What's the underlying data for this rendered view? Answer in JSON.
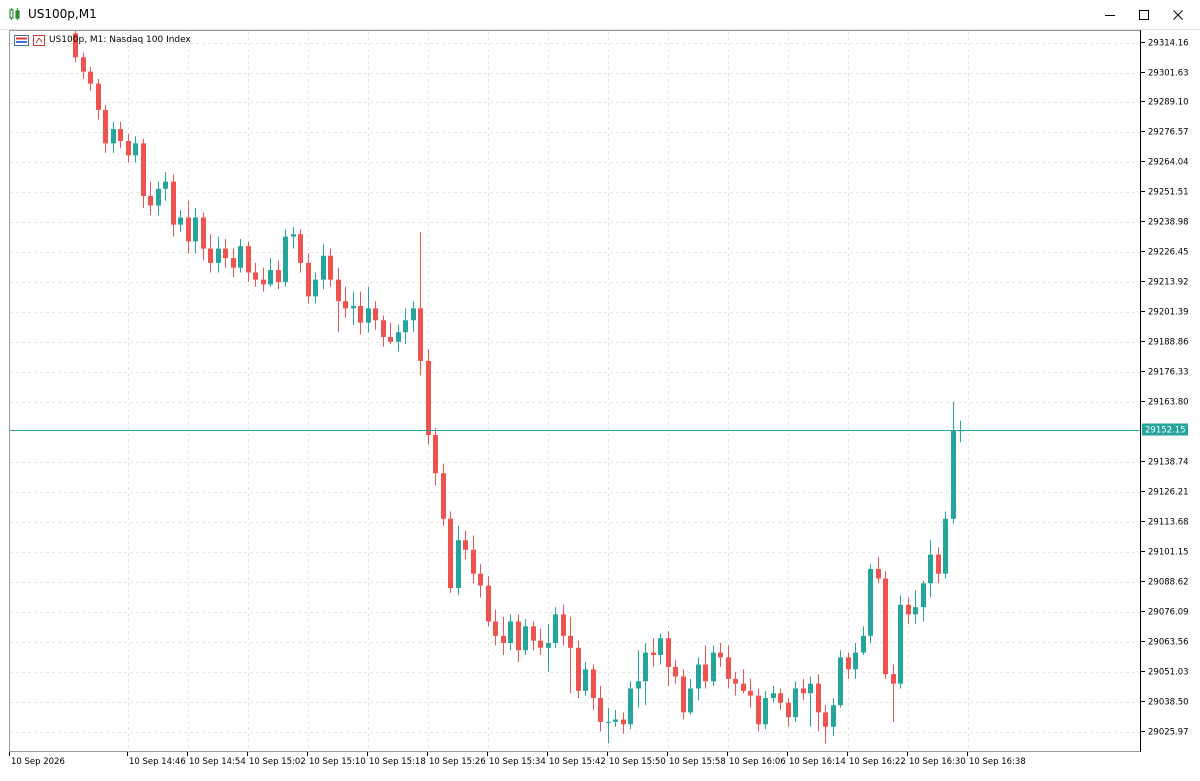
{
  "window": {
    "title": "US100p,M1",
    "chart_label": "US100p, M1:  Nasdaq 100 Index"
  },
  "chart_data": {
    "type": "candlestick",
    "symbol": "US100p",
    "timeframe": "M1",
    "description": "Nasdaq 100 Index",
    "ylim": [
      29017.0,
      29319.0
    ],
    "y_ticks": [
      "29314.16",
      "29301.63",
      "29289.10",
      "29276.57",
      "29264.04",
      "29251.51",
      "29238.98",
      "29226.45",
      "29213.92",
      "29201.39",
      "29188.86",
      "29176.33",
      "29163.80",
      "29138.74",
      "29126.21",
      "29113.68",
      "29101.15",
      "29088.62",
      "29076.09",
      "29063.56",
      "29051.03",
      "29038.50",
      "29025.97"
    ],
    "x_tick_labels": [
      "10 Sep 2026",
      "10 Sep 14:46",
      "10 Sep 14:54",
      "10 Sep 15:02",
      "10 Sep 15:10",
      "10 Sep 15:18",
      "10 Sep 15:26",
      "10 Sep 15:34",
      "10 Sep 15:42",
      "10 Sep 15:50",
      "10 Sep 15:58",
      "10 Sep 16:06",
      "10 Sep 16:14",
      "10 Sep 16:22",
      "10 Sep 16:30",
      "10 Sep 16:38"
    ],
    "current_price": "29152.15",
    "up_color": "#26a69a",
    "down_color": "#ef5350",
    "candles": [
      [
        29318,
        29321,
        29306,
        29308
      ],
      [
        29308,
        29310,
        29299,
        29302
      ],
      [
        29302,
        29304,
        29294,
        29297
      ],
      [
        29297,
        29299,
        29282,
        29286
      ],
      [
        29286,
        29288,
        29268,
        29272
      ],
      [
        29272,
        29281,
        29268,
        29278
      ],
      [
        29278,
        29281,
        29270,
        29273
      ],
      [
        29273,
        29276,
        29264,
        29267
      ],
      [
        29267,
        29275,
        29264,
        29272
      ],
      [
        29272,
        29274,
        29245,
        29250
      ],
      [
        29250,
        29256,
        29242,
        29246
      ],
      [
        29246,
        29256,
        29242,
        29253
      ],
      [
        29253,
        29260,
        29248,
        29256
      ],
      [
        29256,
        29259,
        29233,
        29238
      ],
      [
        29238,
        29244,
        29235,
        29241
      ],
      [
        29241,
        29248,
        29226,
        29231
      ],
      [
        29231,
        29245,
        29226,
        29241
      ],
      [
        29241,
        29243,
        29223,
        29228
      ],
      [
        29228,
        29234,
        29218,
        29222
      ],
      [
        29222,
        29233,
        29218,
        29228
      ],
      [
        29228,
        29232,
        29220,
        29224
      ],
      [
        29224,
        29228,
        29216,
        29220
      ],
      [
        29220,
        29232,
        29218,
        29229
      ],
      [
        29229,
        29231,
        29214,
        29218
      ],
      [
        29218,
        29222,
        29212,
        29215
      ],
      [
        29215,
        29220,
        29210,
        29213
      ],
      [
        29213,
        29224,
        29212,
        29219
      ],
      [
        29219,
        29223,
        29211,
        29214
      ],
      [
        29214,
        29236,
        29212,
        29233
      ],
      [
        29233,
        29237,
        29228,
        29234
      ],
      [
        29234,
        29236,
        29218,
        29222
      ],
      [
        29222,
        29226,
        29205,
        29208
      ],
      [
        29208,
        29218,
        29205,
        29215
      ],
      [
        29215,
        29230,
        29211,
        29225
      ],
      [
        29225,
        29228,
        29212,
        29215
      ],
      [
        29215,
        29220,
        29193,
        29206
      ],
      [
        29206,
        29212,
        29199,
        29203
      ],
      [
        29203,
        29210,
        29196,
        29204
      ],
      [
        29204,
        29210,
        29192,
        29197
      ],
      [
        29197,
        29212,
        29193,
        29203
      ],
      [
        29203,
        29206,
        29194,
        29198
      ],
      [
        29198,
        29200,
        29187,
        29191
      ],
      [
        29191,
        29197,
        29188,
        29189
      ],
      [
        29189,
        29196,
        29185,
        29193
      ],
      [
        29193,
        29203,
        29188,
        29198
      ],
      [
        29198,
        29206,
        29193,
        29203
      ],
      [
        29203,
        29235,
        29175,
        29181
      ],
      [
        29181,
        29186,
        29146,
        29150
      ],
      [
        29150,
        29153,
        29129,
        29134
      ],
      [
        29134,
        29138,
        29112,
        29115
      ],
      [
        29115,
        29118,
        29084,
        29086
      ],
      [
        29086,
        29112,
        29083,
        29106
      ],
      [
        29106,
        29110,
        29098,
        29102
      ],
      [
        29102,
        29108,
        29088,
        29092
      ],
      [
        29092,
        29096,
        29082,
        29087
      ],
      [
        29087,
        29091,
        29070,
        29072
      ],
      [
        29072,
        29077,
        29062,
        29066
      ],
      [
        29066,
        29074,
        29058,
        29063
      ],
      [
        29063,
        29075,
        29060,
        29072
      ],
      [
        29072,
        29075,
        29055,
        29060
      ],
      [
        29060,
        29073,
        29058,
        29070
      ],
      [
        29070,
        29072,
        29060,
        29064
      ],
      [
        29064,
        29069,
        29058,
        29061
      ],
      [
        29061,
        29071,
        29051,
        29063
      ],
      [
        29063,
        29078,
        29061,
        29075
      ],
      [
        29075,
        29079,
        29062,
        29066
      ],
      [
        29066,
        29074,
        29042,
        29061
      ],
      [
        29061,
        29064,
        29040,
        29043
      ],
      [
        29043,
        29055,
        29041,
        29052
      ],
      [
        29052,
        29054,
        29035,
        29040
      ],
      [
        29040,
        29045,
        29026,
        29030
      ],
      [
        29030,
        29036,
        29021,
        29030
      ],
      [
        29030,
        29035,
        29028,
        29031
      ],
      [
        29031,
        29034,
        29025,
        29029
      ],
      [
        29029,
        29047,
        29027,
        29044
      ],
      [
        29044,
        29060,
        29036,
        29047
      ],
      [
        29047,
        29063,
        29037,
        29059
      ],
      [
        29059,
        29065,
        29053,
        29058
      ],
      [
        29058,
        29067,
        29054,
        29065
      ],
      [
        29065,
        29068,
        29045,
        29053
      ],
      [
        29053,
        29056,
        29046,
        29049
      ],
      [
        29049,
        29052,
        29031,
        29034
      ],
      [
        29034,
        29048,
        29033,
        29044
      ],
      [
        29044,
        29057,
        29039,
        29054
      ],
      [
        29054,
        29062,
        29044,
        29047
      ],
      [
        29047,
        29062,
        29045,
        29059
      ],
      [
        29059,
        29063,
        29053,
        29057
      ],
      [
        29057,
        29062,
        29044,
        29048
      ],
      [
        29048,
        29051,
        29041,
        29046
      ],
      [
        29046,
        29052,
        29042,
        29043
      ],
      [
        29043,
        29048,
        29036,
        29041
      ],
      [
        29041,
        29044,
        29026,
        29029
      ],
      [
        29029,
        29043,
        29027,
        29040
      ],
      [
        29040,
        29045,
        29038,
        29042
      ],
      [
        29042,
        29044,
        29035,
        29038
      ],
      [
        29038,
        29040,
        29028,
        29032
      ],
      [
        29032,
        29047,
        29030,
        29044
      ],
      [
        29044,
        29048,
        29039,
        29042
      ],
      [
        29042,
        29049,
        29028,
        29046
      ],
      [
        29046,
        29050,
        29026,
        29034
      ],
      [
        29034,
        29037,
        29021,
        29028
      ],
      [
        29028,
        29040,
        29024,
        29037
      ],
      [
        29037,
        29060,
        29036,
        29057
      ],
      [
        29057,
        29059,
        29048,
        29052
      ],
      [
        29052,
        29063,
        29048,
        29059
      ],
      [
        29059,
        29070,
        29058,
        29066
      ],
      [
        29066,
        29096,
        29063,
        29094
      ],
      [
        29094,
        29099,
        29088,
        29090
      ],
      [
        29090,
        29093,
        29048,
        29050
      ],
      [
        29050,
        29054,
        29030,
        29046
      ],
      [
        29046,
        29083,
        29044,
        29079
      ],
      [
        29079,
        29082,
        29071,
        29075
      ],
      [
        29075,
        29085,
        29071,
        29078
      ],
      [
        29078,
        29089,
        29072,
        29088
      ],
      [
        29088,
        29106,
        29082,
        29100
      ],
      [
        29100,
        29103,
        29088,
        29092
      ],
      [
        29092,
        29118,
        29090,
        29115
      ],
      [
        29115,
        29164,
        29113,
        29152
      ],
      [
        29152,
        29156,
        29147,
        29152
      ]
    ]
  }
}
